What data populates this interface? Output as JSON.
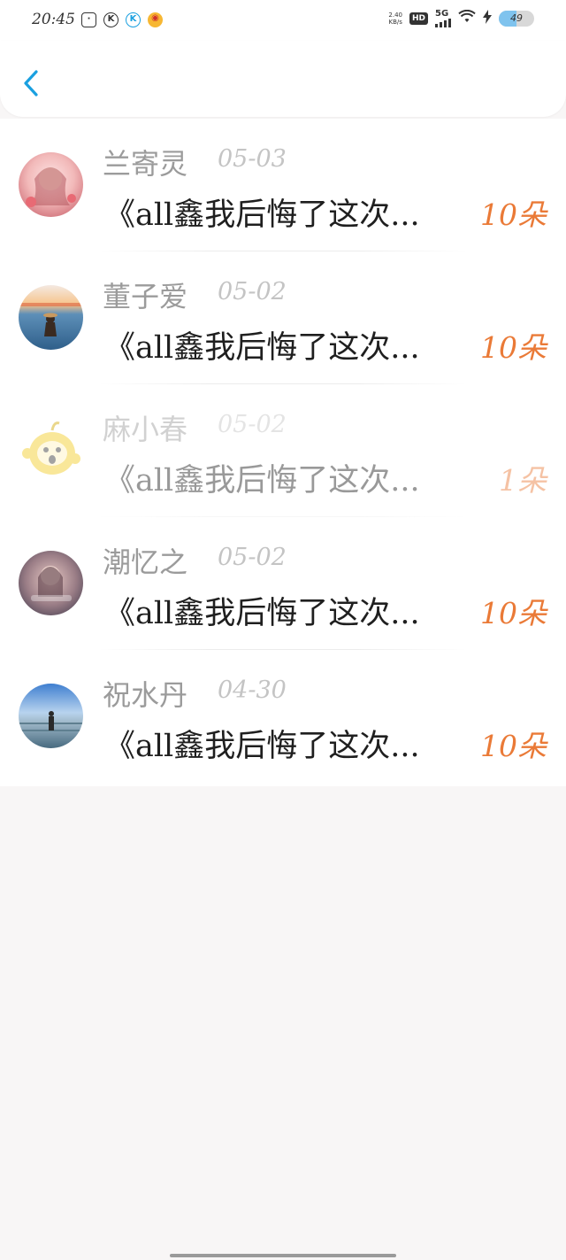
{
  "status_bar": {
    "time": "20:45",
    "network_speed_value": "2.40",
    "network_speed_unit": "KB/s",
    "hd_label": "HD",
    "signal_label": "5G",
    "battery_level": "49",
    "battery_fraction": 0.49
  },
  "header": {
    "back_icon": "chevron-left-icon",
    "accent_color": "#1aa0e0"
  },
  "list": {
    "count_color": "#ea7a37",
    "items": [
      {
        "name": "兰寄灵",
        "date": "05-03",
        "title": "《all鑫我后悔了这次...",
        "count": "10朵",
        "avatar": "anime-girl-avatar",
        "faded": false
      },
      {
        "name": "董子爱",
        "date": "05-02",
        "title": "《all鑫我后悔了这次...",
        "count": "10朵",
        "avatar": "beach-sunset-avatar",
        "faded": false
      },
      {
        "name": "麻小春",
        "date": "05-02",
        "title": "《all鑫我后悔了这次...",
        "count": "1朵",
        "avatar": "yellow-cartoon-avatar",
        "faded": true
      },
      {
        "name": "潮忆之",
        "date": "05-02",
        "title": "《all鑫我后悔了这次...",
        "count": "10朵",
        "avatar": "dreamy-girl-avatar",
        "faded": false
      },
      {
        "name": "祝水丹",
        "date": "04-30",
        "title": "《all鑫我后悔了这次...",
        "count": "10朵",
        "avatar": "seaside-person-avatar",
        "faded": false
      }
    ]
  }
}
